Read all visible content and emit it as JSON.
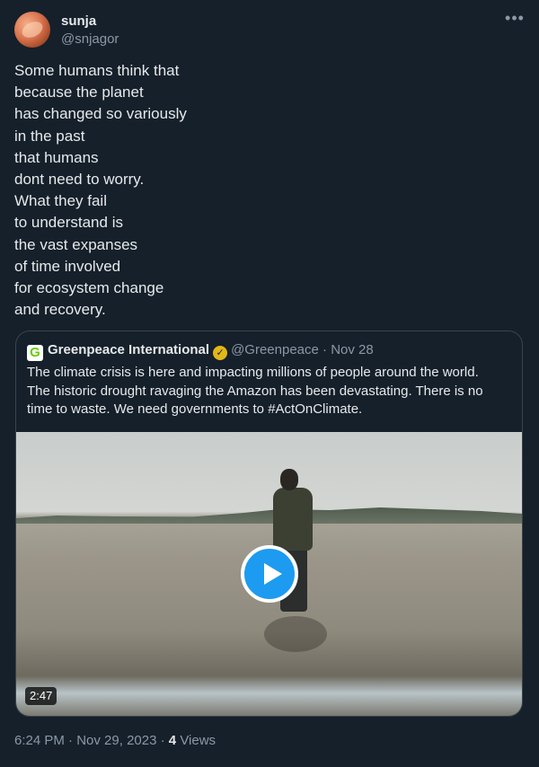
{
  "author": {
    "name": "sunja",
    "handle": "@snjagor",
    "more_icon": "more-horizontal-icon"
  },
  "tweet": {
    "lines": [
      "Some humans think that",
      "because the planet",
      "has changed so variously",
      "in the past",
      "that humans",
      "dont need to worry.",
      "What they fail",
      "to understand is",
      "the vast expanses",
      "of time involved",
      "for ecosystem change",
      "and recovery."
    ]
  },
  "quote": {
    "logo_letter": "G",
    "name": "Greenpeace International",
    "verified_icon": "gold-verified-badge-icon",
    "handle": "@Greenpeace",
    "separator": "·",
    "date": "Nov 28",
    "lines": [
      "The climate crisis is here and impacting millions of people around the world.",
      "The historic drought ravaging the Amazon has been devastating. There is no",
      "time to waste. We need governments to #ActOnClimate."
    ],
    "video": {
      "duration": "2:47",
      "play_icon": "play-icon"
    }
  },
  "footer": {
    "time": "6:24 PM",
    "sep1": "·",
    "date": "Nov 29, 2023",
    "sep2": "·",
    "views_count": "4",
    "views_label": "Views"
  },
  "colors": {
    "background": "#15202b",
    "text": "#e7e9ea",
    "secondary_text": "#8b98a5",
    "accent": "#1d9bf0",
    "border": "#38444d"
  }
}
